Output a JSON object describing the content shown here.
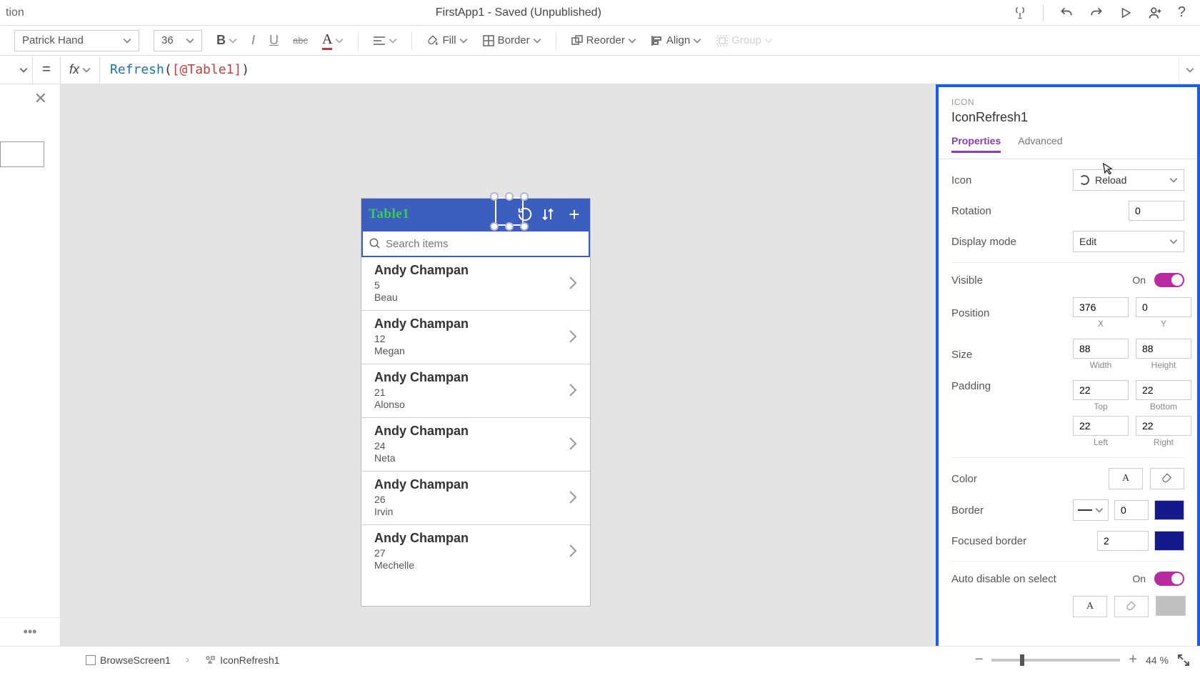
{
  "titlebar": {
    "left_fragment": "tion",
    "doc_title": "FirstApp1 - Saved (Unpublished)"
  },
  "ribbon": {
    "font": "Patrick Hand",
    "font_size": "36",
    "fill_label": "Fill",
    "border_label": "Border",
    "reorder_label": "Reorder",
    "align_label": "Align",
    "group_label": "Group"
  },
  "formula": {
    "fx": "fx",
    "eq": "=",
    "fn": "Refresh",
    "arg1": "(",
    "arg2": "[@Table1]",
    "arg3": ")"
  },
  "phone": {
    "title": "Table1",
    "search_placeholder": "Search items",
    "items": [
      {
        "title": "Andy Champan",
        "line1": "5",
        "line2": "Beau"
      },
      {
        "title": "Andy Champan",
        "line1": "12",
        "line2": "Megan"
      },
      {
        "title": "Andy Champan",
        "line1": "21",
        "line2": "Alonso"
      },
      {
        "title": "Andy Champan",
        "line1": "24",
        "line2": "Neta"
      },
      {
        "title": "Andy Champan",
        "line1": "26",
        "line2": "Irvin"
      },
      {
        "title": "Andy Champan",
        "line1": "27",
        "line2": "Mechelle"
      }
    ]
  },
  "props": {
    "kind": "ICON",
    "name": "IconRefresh1",
    "tabs": {
      "properties": "Properties",
      "advanced": "Advanced"
    },
    "icon_lbl": "Icon",
    "icon_val": "Reload",
    "rotation_lbl": "Rotation",
    "rotation_val": "0",
    "display_lbl": "Display mode",
    "display_val": "Edit",
    "visible_lbl": "Visible",
    "visible_state": "On",
    "position_lbl": "Position",
    "pos_x": "376",
    "pos_y": "0",
    "x_lbl": "X",
    "y_lbl": "Y",
    "size_lbl": "Size",
    "size_w": "88",
    "size_h": "88",
    "w_lbl": "Width",
    "h_lbl": "Height",
    "padding_lbl": "Padding",
    "pad_t": "22",
    "pad_b": "22",
    "pad_l": "22",
    "pad_r": "22",
    "t_lbl": "Top",
    "b_lbl": "Bottom",
    "l_lbl": "Left",
    "r_lbl": "Right",
    "color_lbl": "Color",
    "border_lbl": "Border",
    "border_val": "0",
    "fborder_lbl": "Focused border",
    "fborder_val": "2",
    "auto_lbl": "Auto disable on select",
    "auto_state": "On"
  },
  "bottom": {
    "crumb1": "BrowseScreen1",
    "crumb2": "IconRefresh1",
    "zoom_pct": "44",
    "zoom_unit": "%"
  }
}
